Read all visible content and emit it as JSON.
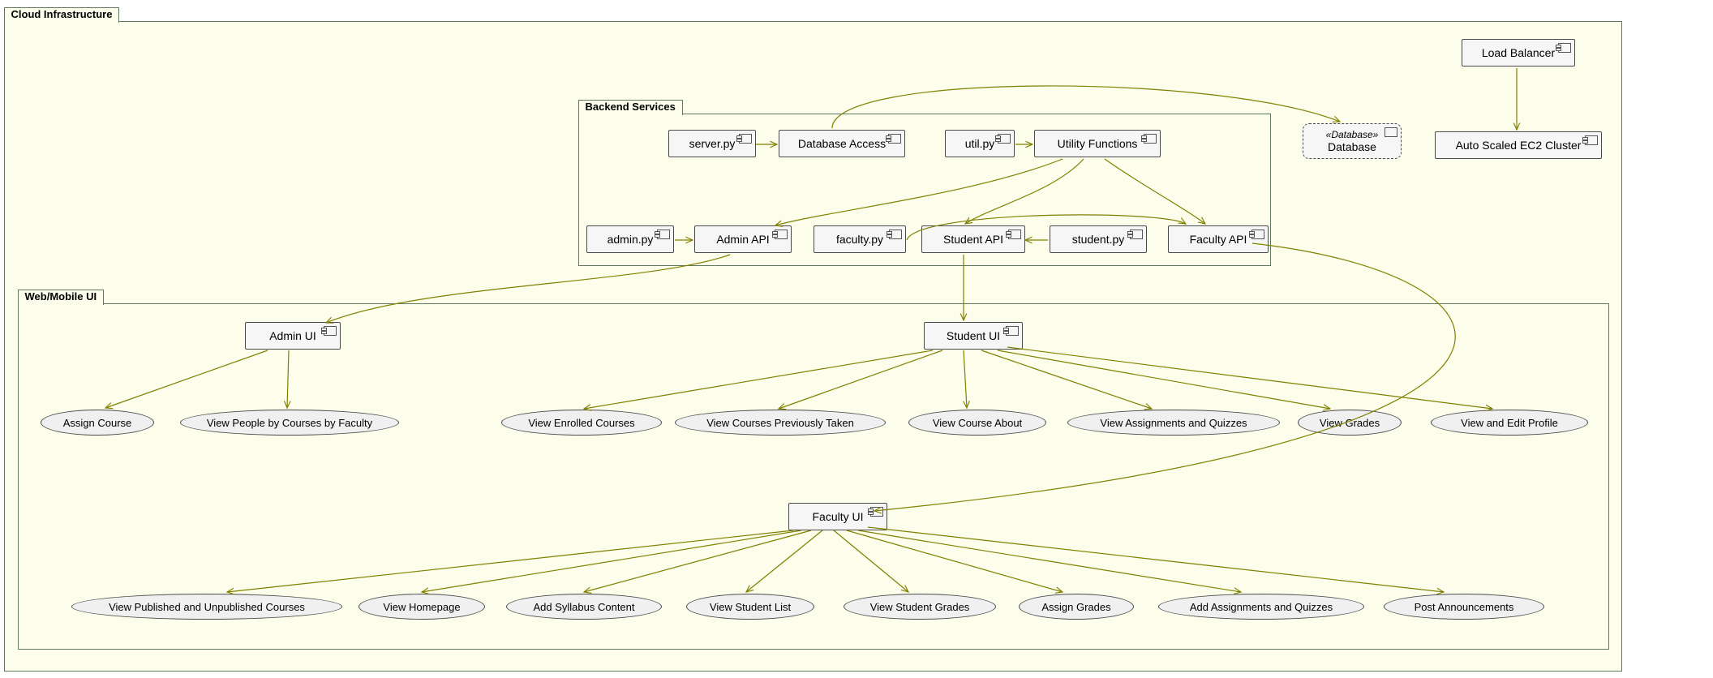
{
  "packages": {
    "cloud": "Cloud Infrastructure",
    "backend": "Backend Services",
    "ui": "Web/Mobile UI"
  },
  "components": {
    "load_balancer": "Load Balancer",
    "ec2": "Auto Scaled EC2 Cluster",
    "server": "server.py",
    "db_access": "Database Access",
    "util": "util.py",
    "util_fn": "Utility Functions",
    "admin_py": "admin.py",
    "admin_api": "Admin API",
    "faculty_py": "faculty.py",
    "student_api": "Student API",
    "student_py": "student.py",
    "faculty_api": "Faculty API",
    "admin_ui": "Admin UI",
    "student_ui": "Student UI",
    "faculty_ui": "Faculty UI"
  },
  "database": {
    "stereo": "«Database»",
    "name": "Database"
  },
  "usecases": {
    "assign_course": "Assign Course",
    "view_people": "View People by Courses by Faculty",
    "view_enrolled": "View Enrolled Courses",
    "view_prev": "View Courses Previously Taken",
    "view_about": "View Course About",
    "view_assign": "View Assignments and Quizzes",
    "view_grades": "View Grades",
    "view_profile": "View and Edit Profile",
    "view_pub": "View Published and Unpublished Courses",
    "view_home": "View Homepage",
    "add_syllabus": "Add Syllabus Content",
    "view_students": "View Student List",
    "view_sgrades": "View Student Grades",
    "assign_grades": "Assign Grades",
    "add_assign": "Add Assignments and Quizzes",
    "post_ann": "Post Announcements"
  }
}
